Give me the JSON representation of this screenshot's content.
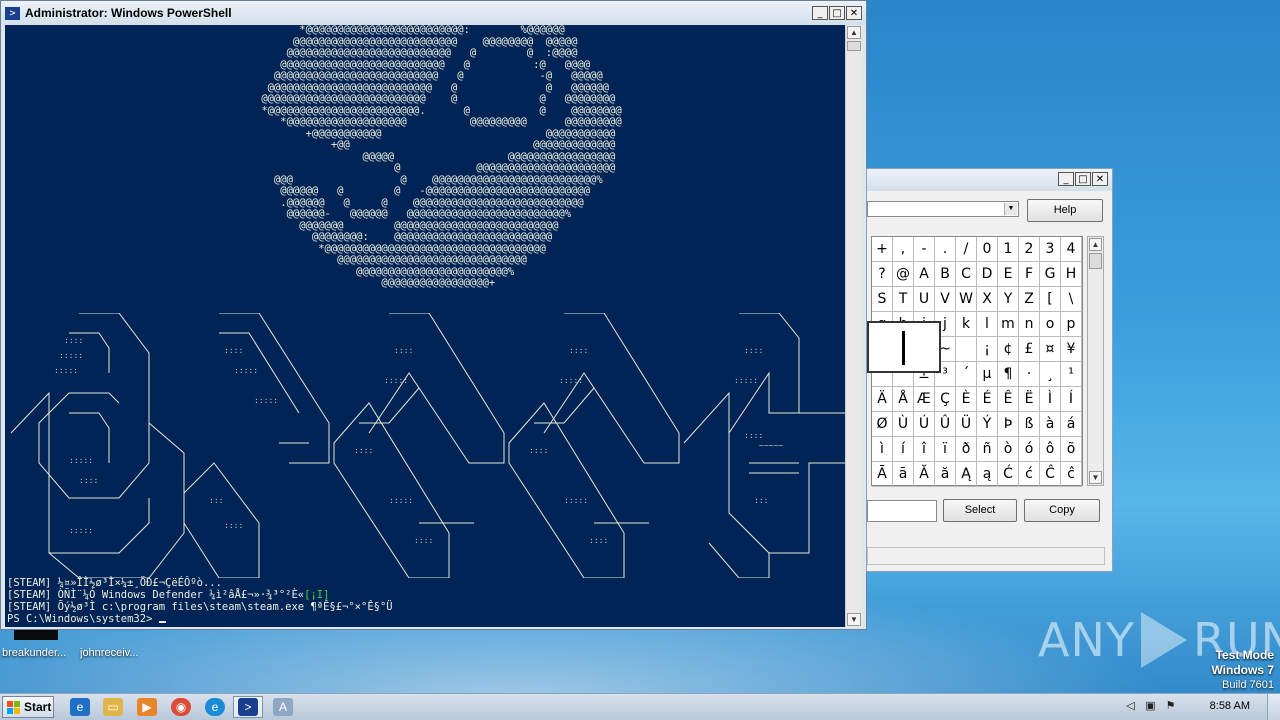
{
  "powershell": {
    "title": "Administrator: Windows PowerShell",
    "console_lines": {
      "line1": "[STEAM] ¼¤»ÎÌ½ø³Ì×¼±¸ÖÐ£¬ÇëÉÔºò...",
      "line2_prefix": "[STEAM] ÒÑÌ¨¼Ó Windows Defender ¼ì²âÅ£¬»·¾³°²È«",
      "line2_suffix": "[¡I]",
      "line3": "[STEAM] Õý½ø³Ì c:\\program files\\steam\\steam.exe ¶ªÊ§£¬°×°Ê§°Ü",
      "prompt": "PS C:\\Windows\\system32> "
    }
  },
  "charmap": {
    "help_label": "Help",
    "select_label": "Select",
    "copy_label": "Copy",
    "grid_rows": [
      [
        "+",
        ",",
        "-",
        ".",
        "/",
        "0",
        "1",
        "2",
        "3",
        "4"
      ],
      [
        "?",
        "@",
        "A",
        "B",
        "C",
        "D",
        "E",
        "F",
        "G",
        "H"
      ],
      [
        "S",
        "T",
        "U",
        "V",
        "W",
        "X",
        "Y",
        "Z",
        "[",
        "\\"
      ],
      [
        "g",
        "h",
        "i",
        "j",
        "k",
        "l",
        "m",
        "n",
        "o",
        "p"
      ],
      [
        "{",
        "|",
        "}",
        "~",
        "",
        "¡",
        "¢",
        "£",
        "¤",
        "¥"
      ],
      [
        "¯",
        "°",
        "±",
        "³",
        "´",
        "µ",
        "¶",
        "·",
        "¸",
        "¹"
      ],
      [
        "Ä",
        "Å",
        "Æ",
        "Ç",
        "È",
        "É",
        "Ê",
        "Ë",
        "Ì",
        "Í"
      ],
      [
        "Ø",
        "Ù",
        "Ú",
        "Û",
        "Ü",
        "Ý",
        "Þ",
        "ß",
        "à",
        "á"
      ],
      [
        "ì",
        "í",
        "î",
        "ï",
        "ð",
        "ñ",
        "ò",
        "ó",
        "ô",
        "õ"
      ],
      [
        "Ā",
        "ā",
        "Ă",
        "ă",
        "Ą",
        "ą",
        "Ć",
        "ć",
        "Ĉ",
        "ĉ"
      ]
    ]
  },
  "desktop": {
    "icon1_label": "breakunder...",
    "icon2_label": "johnreceiv..."
  },
  "watermark": {
    "brand_left": "ANY",
    "brand_right": "RUN",
    "test_mode": "Test Mode",
    "os": "Windows 7",
    "build": "Build 7601"
  },
  "taskbar": {
    "start_label": "Start",
    "clock": "8:58 AM"
  }
}
